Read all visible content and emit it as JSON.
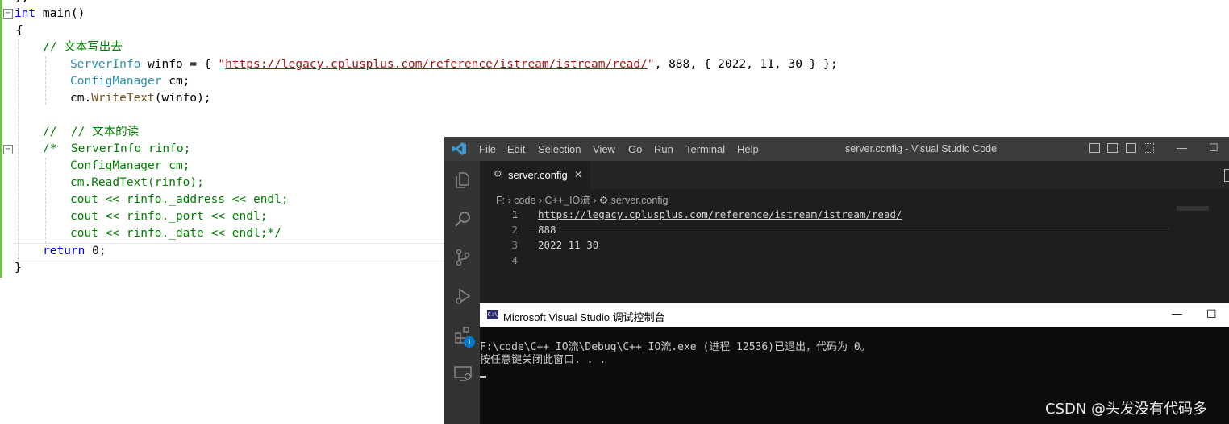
{
  "editor": {
    "top_fragment": "};",
    "lines": {
      "l1_kw": "int",
      "l1_rest": " main()",
      "l2": "{",
      "l3": "// 文本写出去",
      "l4_type": "ServerInfo",
      "l4_a": " winfo = { ",
      "l4_q1": "\"",
      "l4_url": "https://legacy.cplusplus.com/reference/istream/istream/read/",
      "l4_q2": "\"",
      "l4_b": ", 888, { 2022, 11, 30 } };",
      "l5_type": "ConfigManager",
      "l5_rest": " cm;",
      "l6_a": "cm.",
      "l6_fn": "WriteText",
      "l6_b": "(winfo);",
      "l8": "//  // 文本的读",
      "l9": "/*  ServerInfo rinfo;",
      "l10": "ConfigManager cm;",
      "l11": "cm.ReadText(rinfo);",
      "l12": "cout << rinfo._address << endl;",
      "l13": "cout << rinfo._port << endl;",
      "l14": "cout << rinfo._date << endl;*/",
      "l15_kw": "return",
      "l15_rest": " 0;",
      "l16": "}"
    },
    "fold_minus": "−"
  },
  "vscode": {
    "title": "server.config - Visual Studio Code",
    "menu": [
      "File",
      "Edit",
      "Selection",
      "View",
      "Go",
      "Run",
      "Terminal",
      "Help"
    ],
    "tab_label": "server.config",
    "tab_close": "✕",
    "breadcrumb": [
      "F:",
      "code",
      "C++_IO流",
      "server.config"
    ],
    "breadcrumb_sep": "›",
    "extensions_badge": "1",
    "window_buttons": {
      "minimize": "—",
      "maximize": "☐"
    },
    "lines": [
      {
        "num": "1",
        "text": "https://legacy.cplusplus.com/reference/istream/istream/read/"
      },
      {
        "num": "2",
        "text": "888"
      },
      {
        "num": "3",
        "text": "2022 11 30"
      },
      {
        "num": "4",
        "text": ""
      }
    ],
    "colors": {
      "accent": "#007acc",
      "background": "#1e1e1e",
      "titlebar": "#3c3c3c"
    }
  },
  "console": {
    "title": "Microsoft Visual Studio 调试控制台",
    "icon_text": "C:\\",
    "line1": "F:\\code\\C++_IO流\\Debug\\C++_IO流.exe (进程 12536)已退出，代码为 0。",
    "line2": "按任意键关闭此窗口. . .",
    "window_buttons": {
      "minimize": "—",
      "maximize": "☐"
    }
  },
  "watermark": "CSDN @头发没有代码多"
}
